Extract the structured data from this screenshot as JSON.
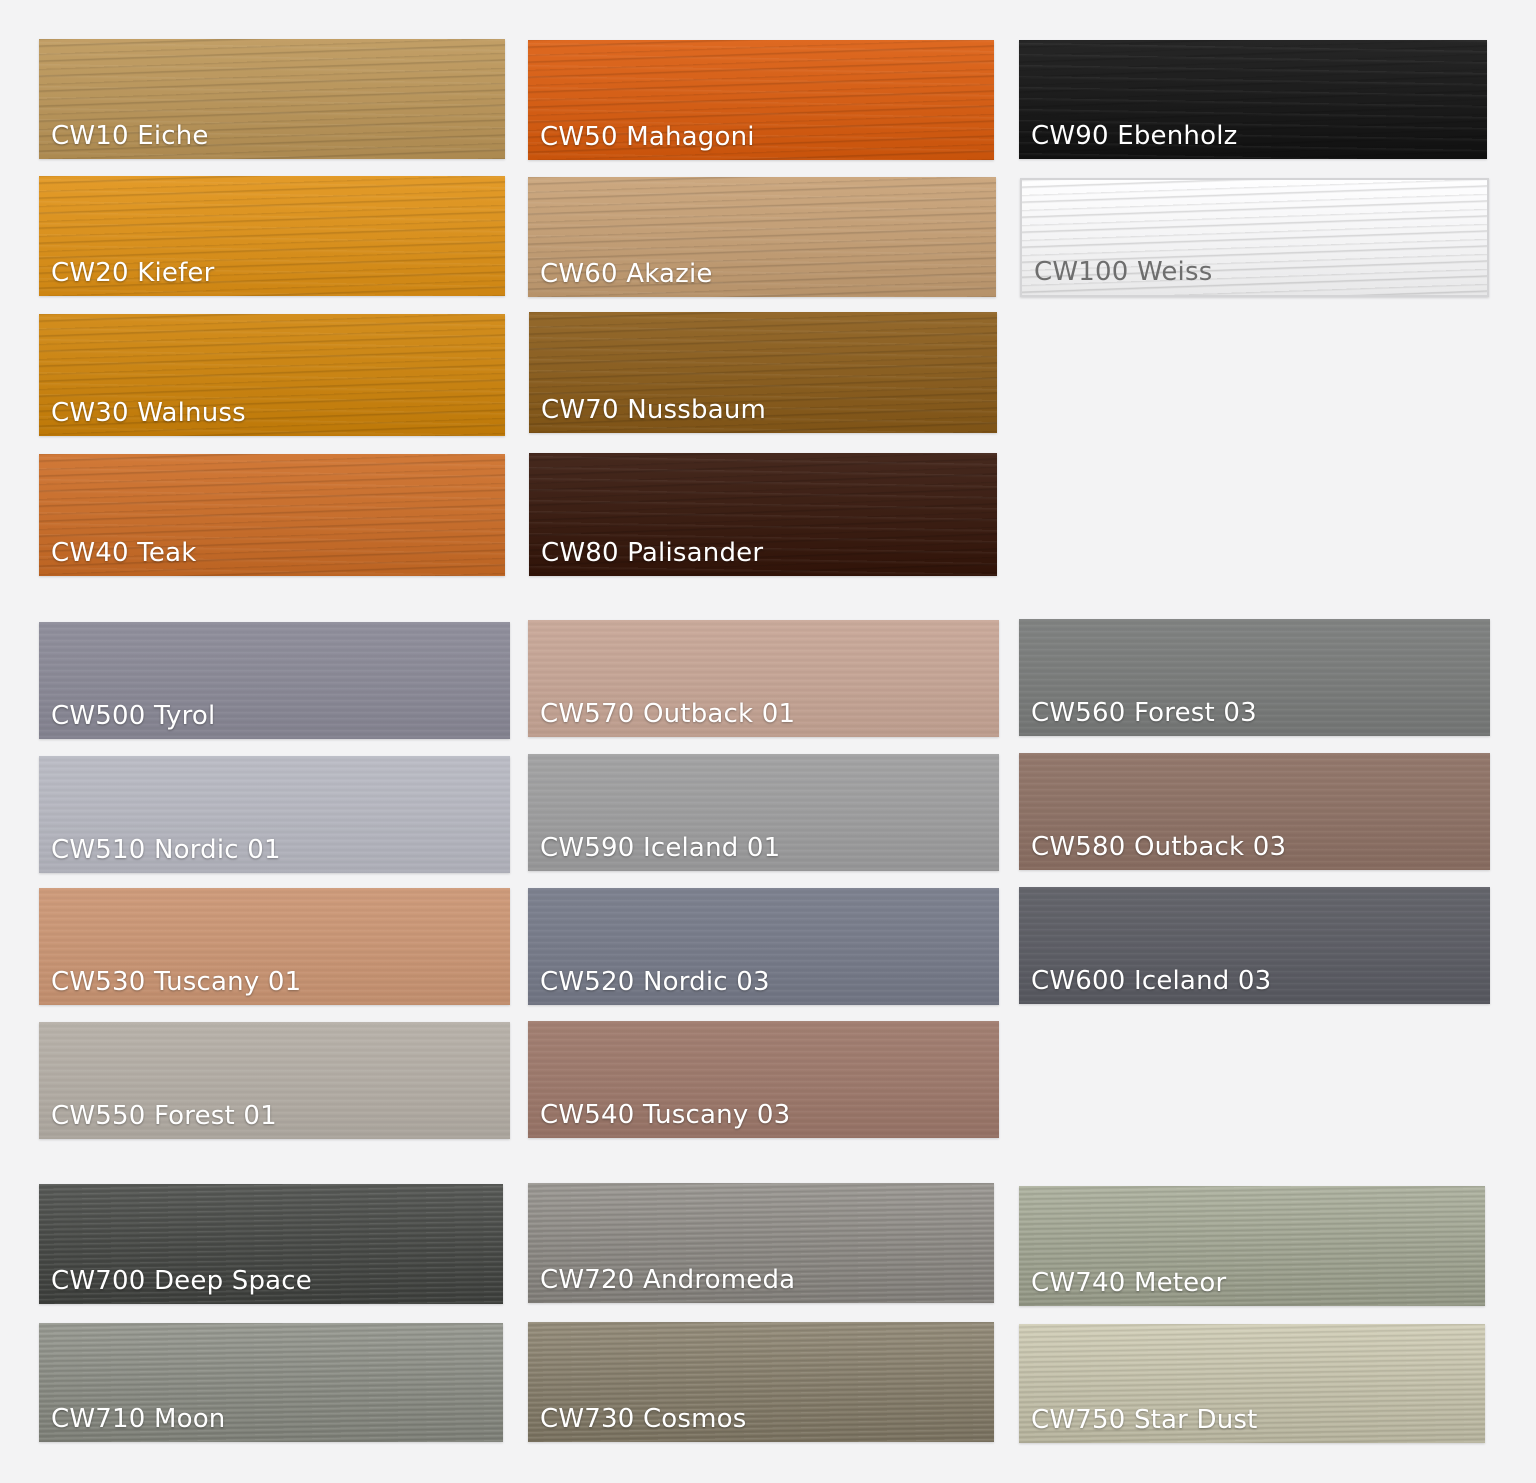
{
  "swatches": [
    {
      "id": "cw10",
      "label": "CW10 Eiche",
      "color": "#b8955c",
      "texture": "wood",
      "group": "wood"
    },
    {
      "id": "cw20",
      "label": "CW20 Kiefer",
      "color": "#d9911f",
      "texture": "wood",
      "group": "wood"
    },
    {
      "id": "cw30",
      "label": "CW30 Walnuss",
      "color": "#c98414",
      "texture": "wood",
      "group": "wood"
    },
    {
      "id": "cw40",
      "label": "CW40 Teak",
      "color": "#c76f2e",
      "texture": "wood",
      "group": "wood"
    },
    {
      "id": "cw50",
      "label": "CW50 Mahagoni",
      "color": "#d45f17",
      "texture": "wood",
      "group": "wood"
    },
    {
      "id": "cw60",
      "label": "CW60 Akazie",
      "color": "#c29e76",
      "texture": "wood",
      "group": "wood"
    },
    {
      "id": "cw70",
      "label": "CW70 Nussbaum",
      "color": "#8a5f22",
      "texture": "wood",
      "group": "wood"
    },
    {
      "id": "cw80",
      "label": "CW80 Palisander",
      "color": "#3c1f14",
      "texture": "wood",
      "group": "wood"
    },
    {
      "id": "cw90",
      "label": "CW90 Ebenholz",
      "color": "#1c1c1c",
      "texture": "wood",
      "group": "wood"
    },
    {
      "id": "cw100",
      "label": "CW100 Weiss",
      "color": "#f4f4f5",
      "texture": "wood",
      "group": "wood",
      "light": true
    },
    {
      "id": "cw500",
      "label": "CW500 Tyrol",
      "color": "#8b8a97",
      "texture": "stain",
      "group": "stain"
    },
    {
      "id": "cw510",
      "label": "CW510 Nordic 01",
      "color": "#b6b7c0",
      "texture": "stain",
      "group": "stain"
    },
    {
      "id": "cw530",
      "label": "CW530 Tuscany 01",
      "color": "#c99676",
      "texture": "stain",
      "group": "stain"
    },
    {
      "id": "cw550",
      "label": "CW550 Forest 01",
      "color": "#b3ada5",
      "texture": "stain",
      "group": "stain"
    },
    {
      "id": "cw570",
      "label": "CW570 Outback 01",
      "color": "#c5a596",
      "texture": "stain",
      "group": "stain"
    },
    {
      "id": "cw590",
      "label": "CW590 Iceland 01",
      "color": "#9e9e9f",
      "texture": "stain",
      "group": "stain"
    },
    {
      "id": "cw520",
      "label": "CW520 Nordic 03",
      "color": "#787c8a",
      "texture": "stain",
      "group": "stain"
    },
    {
      "id": "cw540",
      "label": "CW540 Tuscany 03",
      "color": "#9d7a6d",
      "texture": "stain",
      "group": "stain"
    },
    {
      "id": "cw560",
      "label": "CW560 Forest 03",
      "color": "#7b7d7c",
      "texture": "stain",
      "group": "stain"
    },
    {
      "id": "cw580",
      "label": "CW580 Outback 03",
      "color": "#8e7367",
      "texture": "stain",
      "group": "stain"
    },
    {
      "id": "cw600",
      "label": "CW600 Iceland 03",
      "color": "#5e5f66",
      "texture": "stain",
      "group": "stain"
    },
    {
      "id": "cw700",
      "label": "CW700 Deep Space",
      "color": "#4b4d4a",
      "texture": "metal",
      "group": "metallic"
    },
    {
      "id": "cw710",
      "label": "CW710 Moon",
      "color": "#8c8e86",
      "texture": "metal",
      "group": "metallic"
    },
    {
      "id": "cw720",
      "label": "CW720 Andromeda",
      "color": "#8f8c87",
      "texture": "metal",
      "group": "metallic"
    },
    {
      "id": "cw730",
      "label": "CW730 Cosmos",
      "color": "#88806e",
      "texture": "metal",
      "group": "metallic"
    },
    {
      "id": "cw740",
      "label": "CW740 Meteor",
      "color": "#a2a694",
      "texture": "metal",
      "group": "metallic"
    },
    {
      "id": "cw750",
      "label": "CW750 Star Dust",
      "color": "#c5c2ac",
      "texture": "metal",
      "group": "metallic"
    }
  ]
}
